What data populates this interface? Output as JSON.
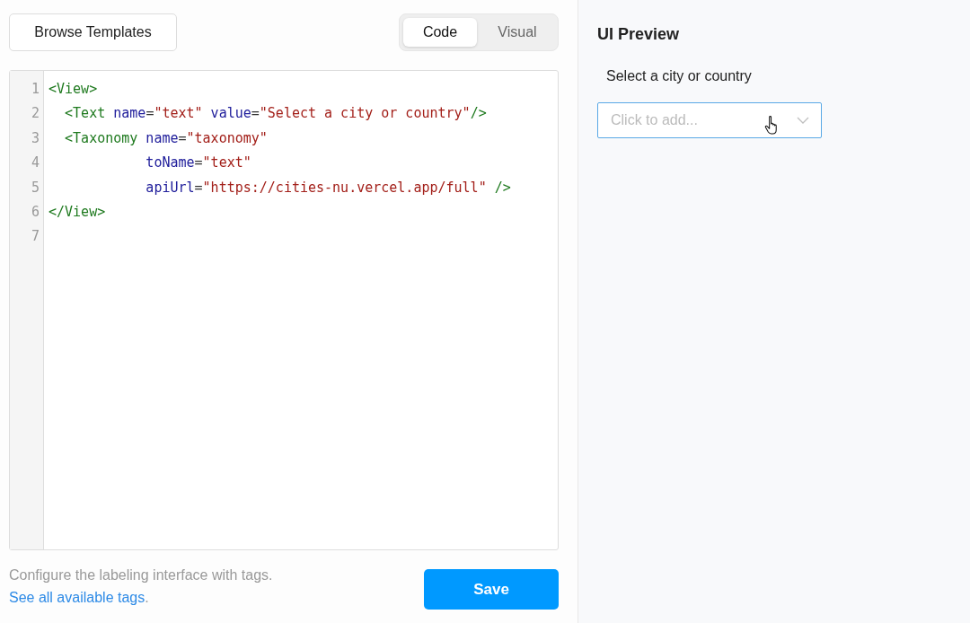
{
  "toolbar": {
    "browse_button": "Browse Templates",
    "tabs": [
      {
        "label": "Code",
        "selected": true
      },
      {
        "label": "Visual",
        "selected": false
      }
    ]
  },
  "editor": {
    "lines": [
      {
        "number": "1",
        "tokens": [
          {
            "kind": "tag",
            "text": "<View>"
          }
        ]
      },
      {
        "number": "2",
        "tokens": [
          {
            "kind": "tag",
            "text": "  <Text"
          },
          {
            "kind": "attr",
            "text": " name"
          },
          {
            "kind": "punct",
            "text": "="
          },
          {
            "kind": "string",
            "text": "\"text\""
          },
          {
            "kind": "attr",
            "text": " value"
          },
          {
            "kind": "punct",
            "text": "="
          },
          {
            "kind": "string",
            "text": "\"Select a city or country\""
          },
          {
            "kind": "tag",
            "text": "/>"
          }
        ]
      },
      {
        "number": "3",
        "tokens": [
          {
            "kind": "tag",
            "text": "  <Taxonomy"
          },
          {
            "kind": "attr",
            "text": " name"
          },
          {
            "kind": "punct",
            "text": "="
          },
          {
            "kind": "string",
            "text": "\"taxonomy\""
          }
        ]
      },
      {
        "number": "4",
        "tokens": [
          {
            "kind": "attr",
            "text": "            toName"
          },
          {
            "kind": "punct",
            "text": "="
          },
          {
            "kind": "string",
            "text": "\"text\""
          }
        ]
      },
      {
        "number": "5",
        "tokens": [
          {
            "kind": "attr",
            "text": "            apiUrl"
          },
          {
            "kind": "punct",
            "text": "="
          },
          {
            "kind": "string",
            "text": "\"https://cities-nu.vercel.app/full\""
          },
          {
            "kind": "tag",
            "text": " />"
          }
        ]
      },
      {
        "number": "6",
        "tokens": [
          {
            "kind": "tag",
            "text": "</View>"
          }
        ]
      },
      {
        "number": "7"
      }
    ]
  },
  "footer": {
    "hint": "Configure the labeling interface with tags.",
    "link": "See all available tags",
    "link_suffix": ".",
    "save_button": "Save"
  },
  "preview": {
    "title": "UI Preview",
    "label": "Select a city or country",
    "dropdown": {
      "placeholder": "Click to add..."
    }
  }
}
